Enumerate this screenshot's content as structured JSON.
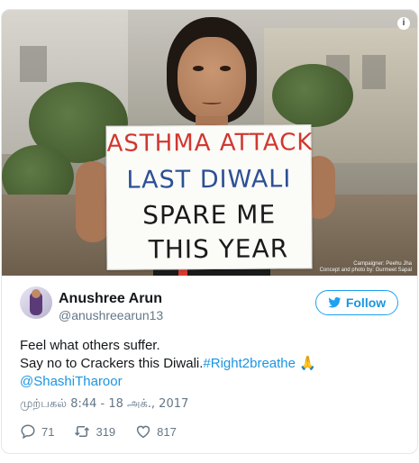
{
  "media": {
    "sign_lines": [
      "ASTHMA ATTACK",
      "LAST DIWALI",
      "SPARE ME",
      "THIS YEAR"
    ],
    "credit_line1": "Campaigner: Peehu Jha",
    "credit_line2": "Concept and photo by: Gurmeet Sapal",
    "info_icon": "info-icon"
  },
  "author": {
    "name": "Anushree Arun",
    "handle": "@anushreearun13"
  },
  "follow": {
    "label": "Follow",
    "icon": "twitter-bird-icon"
  },
  "tweet": {
    "line1": "Feel what others suffer.",
    "line2_text": "Say no to Crackers this Diwali.",
    "hashtag": "#Right2breathe",
    "emoji": "🙏",
    "mention": "@ShashiTharoor"
  },
  "timestamp": "முற்பகல் 8:44 - 18 அக்., 2017",
  "actions": {
    "replies": "71",
    "retweets": "319",
    "likes": "817"
  },
  "colors": {
    "link": "#1b95e0",
    "secondary": "#657786",
    "border": "#e1e8ed"
  }
}
